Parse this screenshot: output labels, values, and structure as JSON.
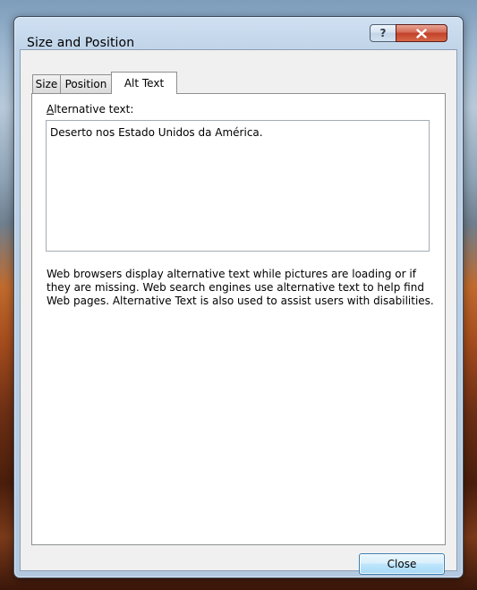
{
  "window": {
    "title": "Size and Position",
    "help_label": "?",
    "close_icon": "close-icon"
  },
  "tabs": [
    {
      "label": "Size",
      "active": false
    },
    {
      "label": "Position",
      "active": false
    },
    {
      "label": "Alt Text",
      "active": true
    }
  ],
  "alt_text": {
    "label_mnemonic": "A",
    "label_rest": "lternative text:",
    "value": "Deserto nos Estado Unidos da América.",
    "description": "Web browsers display alternative text while pictures are loading or if they are missing.  Web search engines use alternative text to help find Web pages.  Alternative Text is also used to assist users with disabilities."
  },
  "buttons": {
    "close_label": "Close"
  }
}
